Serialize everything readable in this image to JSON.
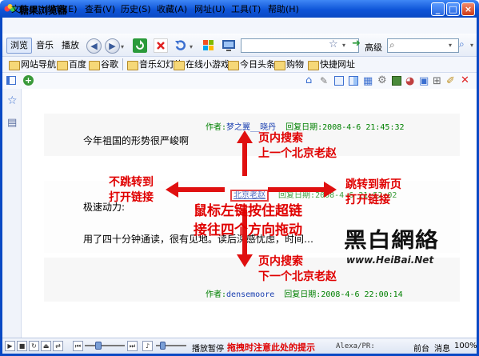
{
  "window": {
    "title": "糖果浏览器"
  },
  "menu": [
    "文件(F)",
    "编辑(E)",
    "查看(V)",
    "历史(S)",
    "收藏(A)",
    "网址(U)",
    "工具(T)",
    "帮助(H)"
  ],
  "toolbar": {
    "modes": [
      "浏览",
      "音乐",
      "播放"
    ],
    "go_label": "高级"
  },
  "favorites": [
    "网站导航",
    "百度",
    "谷歌",
    "音乐幻灯片",
    "在线小游戏",
    "今日头条",
    "购物",
    "快捷网址"
  ],
  "posts": [
    {
      "author_label": "作者:",
      "author": "梦之翼__晓丹",
      "date_label": "回复日期:",
      "date": "2008-4-6  21:45:32",
      "text": "今年祖国的形势很严峻啊"
    },
    {
      "author": "北京老赵",
      "date_label": "回复日期:",
      "date": "2008-4-6  21:52:02",
      "text": "极速动力:",
      "text2": "用了四十分钟通读，很有见地。读后深感忧虑，时间…"
    },
    {
      "author_label": "作者:",
      "author": "densemoore",
      "date_label": "回复日期:",
      "date": "2008-4-6  22:00:14"
    }
  ],
  "annotations": {
    "up": [
      "页内搜索",
      "上一个北京老赵"
    ],
    "left": [
      "不跳转到",
      "打开链接"
    ],
    "right": [
      "跳转到新页",
      "打开链接"
    ],
    "center": [
      "鼠标左键按住超链",
      "接往四个方向拖动"
    ],
    "down": [
      "页内搜索",
      "下一个北京老赵"
    ]
  },
  "watermark": {
    "brand": "黑白網絡",
    "url": "www.HeiBai.Net"
  },
  "status": {
    "play_label": "播放暂停",
    "hint": "拖拽时注意此处的提示",
    "alexa": "Alexa/PR:",
    "tab1": "前台",
    "tab2": "消息",
    "zoom": "100%"
  },
  "colors": {
    "title": "#0a49c4",
    "annotation": "#e00000",
    "meta": "#008000",
    "link": "#1a3fb0"
  }
}
